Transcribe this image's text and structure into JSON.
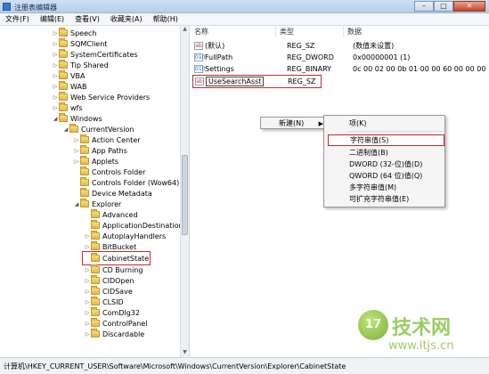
{
  "window": {
    "title": "注册表编辑器",
    "minimize": "–",
    "maximize": "□",
    "close": "✕"
  },
  "menu": [
    "文件(F)",
    "编辑(E)",
    "查看(V)",
    "收藏夹(A)",
    "帮助(H)"
  ],
  "tree": {
    "items": [
      {
        "label": "Speech",
        "expanded": false
      },
      {
        "label": "SQMClient",
        "expanded": false
      },
      {
        "label": "SystemCertificates",
        "expanded": false
      },
      {
        "label": "Tip Shared",
        "expanded": false
      },
      {
        "label": "VBA",
        "expanded": false
      },
      {
        "label": "WAB",
        "expanded": false
      },
      {
        "label": "Web Service Providers",
        "expanded": false
      },
      {
        "label": "wfs",
        "expanded": false
      },
      {
        "label": "Windows",
        "expanded": true
      },
      {
        "label": "CurrentVersion",
        "expanded": true
      },
      {
        "label": "Action Center",
        "expanded": false
      },
      {
        "label": "App Paths",
        "expanded": false
      },
      {
        "label": "Applets",
        "expanded": false
      },
      {
        "label": "Controls Folder",
        "expanded": false
      },
      {
        "label": "Controls Folder (Wow64)",
        "expanded": false
      },
      {
        "label": "Device Metadata",
        "expanded": false
      },
      {
        "label": "Explorer",
        "expanded": true
      },
      {
        "label": "Advanced",
        "expanded": false
      },
      {
        "label": "ApplicationDestinations",
        "expanded": false
      },
      {
        "label": "AutoplayHandlers",
        "expanded": false
      },
      {
        "label": "BitBucket",
        "expanded": false
      },
      {
        "label": "CabinetState",
        "expanded": false
      },
      {
        "label": "CD Burning",
        "expanded": false
      },
      {
        "label": "CIDOpen",
        "expanded": false
      },
      {
        "label": "CIDSave",
        "expanded": false
      },
      {
        "label": "CLSID",
        "expanded": false
      },
      {
        "label": "ComDlg32",
        "expanded": false
      },
      {
        "label": "ControlPanel",
        "expanded": false
      },
      {
        "label": "Discardable",
        "expanded": false
      }
    ]
  },
  "values": {
    "headers": [
      "名称",
      "类型",
      "数据"
    ],
    "rows": [
      {
        "name": "(默认)",
        "type": "REG_SZ",
        "data": "(数值未设置)",
        "icon": "ab"
      },
      {
        "name": "FullPath",
        "type": "REG_DWORD",
        "data": "0x00000001 (1)",
        "icon": "010"
      },
      {
        "name": "Settings",
        "type": "REG_BINARY",
        "data": "0c 00 02 00 0b 01 00 00 60 00 00 00",
        "icon": "010"
      },
      {
        "name": "UseSearchAsst",
        "type": "REG_SZ",
        "data": "",
        "icon": "ab"
      }
    ]
  },
  "context_menu": {
    "new_label": "新建(N)",
    "items": [
      "项(K)",
      "字符串值(S)",
      "二进制值(B)",
      "DWORD (32-位)值(D)",
      "QWORD (64 位)值(Q)",
      "多字符串值(M)",
      "可扩充字符串值(E)"
    ]
  },
  "status": "计算机\\HKEY_CURRENT_USER\\Software\\Microsoft\\Windows\\CurrentVersion\\Explorer\\CabinetState",
  "watermark": {
    "logo": "17",
    "text": "技术网",
    "url": "www.itjs.cn"
  },
  "colors": {
    "highlight": "#c8282e",
    "titlebar": "#cfe0f3",
    "watermark": "#8bc34a"
  }
}
